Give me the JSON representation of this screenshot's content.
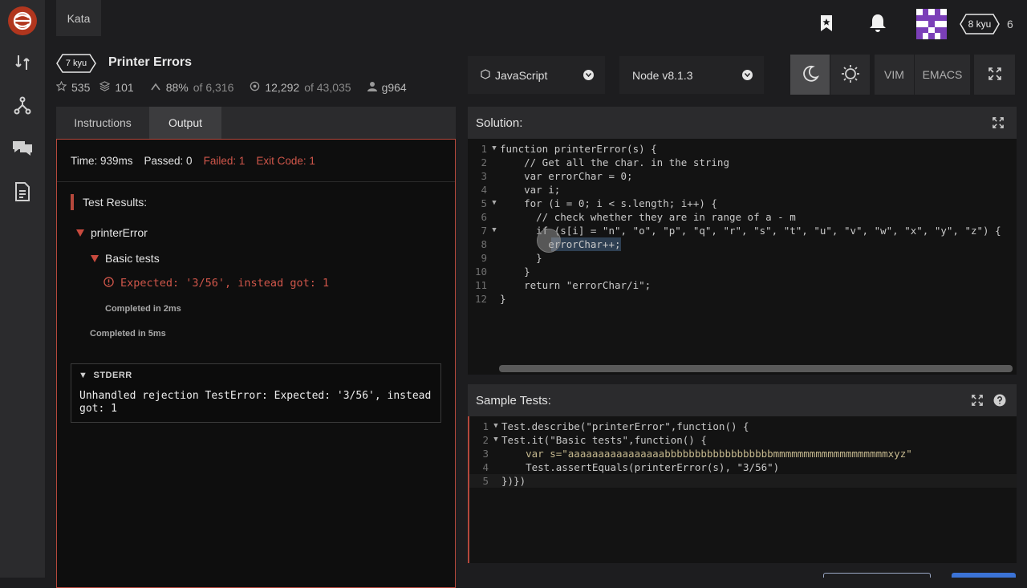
{
  "topbar": {
    "kata_tab": "Kata",
    "user_rank": "8 kyu",
    "honor": "6"
  },
  "kata": {
    "rank": "7 kyu",
    "title": "Printer Errors",
    "stars": "535",
    "collections": "101",
    "satisfaction": "88%",
    "satisfaction_of": "of 6,316",
    "completed": "12,292",
    "completed_of": "of 43,035",
    "author": "g964"
  },
  "editor_controls": {
    "language": "JavaScript",
    "version": "Node v8.1.3",
    "vim": "VIM",
    "emacs": "EMACS"
  },
  "left_tabs": {
    "instructions": "Instructions",
    "output": "Output"
  },
  "output": {
    "time": "Time: 939ms",
    "passed": "Passed: 0",
    "failed": "Failed: 1",
    "exit_code": "Exit Code: 1",
    "test_results_heading": "Test Results:",
    "suite": "printerError",
    "subsuite": "Basic tests",
    "error": "Expected: '3/56', instead got: 1",
    "completed_inner": "Completed in 2ms",
    "completed_outer": "Completed in 5ms",
    "stderr_heading": "STDERR",
    "stderr_body": "Unhandled rejection TestError: Expected: '3/56', instead got: 1"
  },
  "solution": {
    "heading": "Solution:",
    "lines": [
      "function printerError(s) {",
      "    // Get all the char. in the string",
      "    var errorChar = 0;",
      "    var i;",
      "    for (i = 0; i < s.length; i++) {",
      "      // check whether they are in range of a - m",
      "      if (s[i] = \"n\", \"o\", \"p\", \"q\", \"r\", \"s\", \"t\", \"u\", \"v\", \"w\", \"x\", \"y\", \"z\") {",
      "        errorChar++;",
      "      }",
      "    }",
      "    return \"errorChar/i\";",
      "}"
    ]
  },
  "sample_tests": {
    "heading": "Sample Tests:",
    "lines": [
      "Test.describe(\"printerError\",function() {",
      "Test.it(\"Basic tests\",function() {",
      "    var s=\"aaaaaaaaaaaaaaaabbbbbbbbbbbbbbbbbbmmmmmmmmmmmmmmmmmmmxyz\"",
      "    Test.assertEquals(printerError(s), \"3/56\")",
      "})})"
    ]
  },
  "colors": {
    "accent_red": "#b5483c",
    "brand": "#b1361e",
    "avatar_purple": "#7b3fb8"
  },
  "icons": [
    "codewars-logo",
    "practice-icon",
    "fork-icon",
    "discuss-icon",
    "docs-icon",
    "bookmark-icon",
    "bell-icon",
    "star-icon",
    "collection-icon",
    "satisfaction-icon",
    "target-icon",
    "user-icon",
    "language-icon",
    "moon-icon",
    "sun-icon",
    "fullscreen-icon",
    "help-icon"
  ]
}
